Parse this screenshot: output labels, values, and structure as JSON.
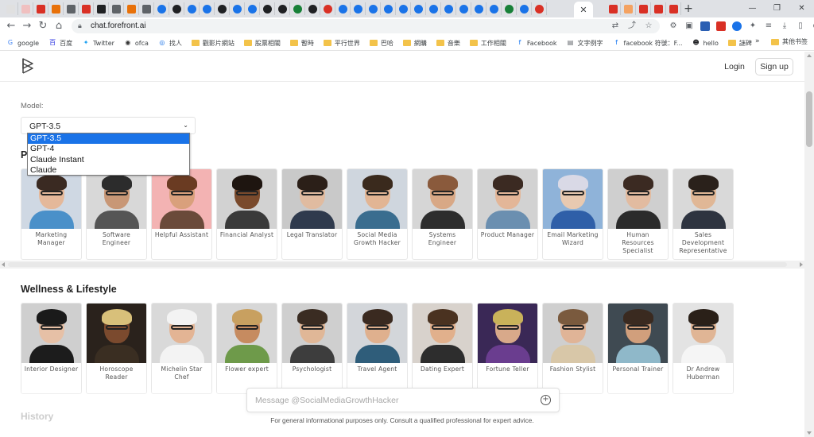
{
  "browser": {
    "url": "chat.forefront.ai",
    "window_controls": {
      "minimize": "—",
      "restore": "❐",
      "close": "✕"
    },
    "active_tab_close": "✕",
    "new_tab": "+",
    "bookmarks": [
      {
        "label": "google",
        "icon": "google-icon"
      },
      {
        "label": "百度",
        "icon": "baidu-icon"
      },
      {
        "label": "Twitter",
        "icon": "twitter-icon"
      },
      {
        "label": "ofca",
        "icon": "globe-icon"
      },
      {
        "label": "找人",
        "icon": "chrome-icon"
      },
      {
        "label": "觀影片網站",
        "icon": "folder-icon"
      },
      {
        "label": "股票相關",
        "icon": "folder-icon"
      },
      {
        "label": "暫時",
        "icon": "folder-icon"
      },
      {
        "label": "平行世界",
        "icon": "folder-icon"
      },
      {
        "label": "巴哈",
        "icon": "folder-icon"
      },
      {
        "label": "網購",
        "icon": "folder-icon"
      },
      {
        "label": "音樂",
        "icon": "folder-icon"
      },
      {
        "label": "工作相關",
        "icon": "folder-icon"
      },
      {
        "label": "Facebook",
        "icon": "facebook-icon"
      },
      {
        "label": "文字例字",
        "icon": "doc-icon"
      },
      {
        "label": "facebook 符號：F...",
        "icon": "facebook-icon"
      },
      {
        "label": "hello",
        "icon": "user-icon"
      },
      {
        "label": "謎碑",
        "icon": "folder-icon"
      }
    ],
    "bookmarks_more": "»",
    "other_bookmarks": "其他书签"
  },
  "header": {
    "login_label": "Login",
    "signup_label": "Sign up"
  },
  "model": {
    "label": "Model:",
    "selected": "GPT-3.5",
    "options": [
      "GPT-3.5",
      "GPT-4",
      "Claude Instant",
      "Claude"
    ]
  },
  "section1": {
    "title_partial": "P",
    "cards": [
      {
        "label": "Marketing Manager",
        "colors": [
          "#cfd8e3",
          "#e4b89a",
          "#3a2a22",
          "#4a90c9"
        ]
      },
      {
        "label": "Software Engineer",
        "colors": [
          "#d8d8d8",
          "#c89776",
          "#2c2c2c",
          "#555555"
        ]
      },
      {
        "label": "Helpful Assistant",
        "colors": [
          "#f3b3b3",
          "#d9a07c",
          "#6a3b22",
          "#6a4a3a"
        ]
      },
      {
        "label": "Financial Analyst",
        "colors": [
          "#d2d2d2",
          "#7a4a2c",
          "#1e1510",
          "#3a3a3a"
        ]
      },
      {
        "label": "Legal Translator",
        "colors": [
          "#c9c9c9",
          "#e0bba0",
          "#2b1f18",
          "#2f3a4d"
        ]
      },
      {
        "label": "Social Media Growth Hacker",
        "colors": [
          "#cfd6de",
          "#e2b594",
          "#3a2a1d",
          "#3a6d8f"
        ]
      },
      {
        "label": "Systems Engineer",
        "colors": [
          "#d6d6d6",
          "#d8a886",
          "#8a5a3c",
          "#2d2d2d"
        ]
      },
      {
        "label": "Product Manager",
        "colors": [
          "#d2d2d2",
          "#e3b698",
          "#3b2a22",
          "#6b8fb0"
        ]
      },
      {
        "label": "Email Marketing Wizard",
        "colors": [
          "#8fb3d9",
          "#e8c9b0",
          "#d9d9e6",
          "#2f5fa8"
        ]
      },
      {
        "label": "Human Resources Specialist",
        "colors": [
          "#cfcfcf",
          "#e2bba0",
          "#3b2a22",
          "#2b2b2b"
        ]
      },
      {
        "label": "Sales Development Representative",
        "colors": [
          "#d9d9d9",
          "#e0b796",
          "#2a211b",
          "#2e3440"
        ]
      }
    ]
  },
  "section2": {
    "title": "Wellness & Lifestyle",
    "cards": [
      {
        "label": "Interior Designer",
        "colors": [
          "#cfcfcf",
          "#e6c0a6",
          "#1a1a1a",
          "#1c1c1c"
        ]
      },
      {
        "label": "Horoscope Reader",
        "colors": [
          "#2a221c",
          "#7b4a2e",
          "#d8c07a",
          "#3a2e22"
        ]
      },
      {
        "label": "Michelin Star Chef",
        "colors": [
          "#d9d9d9",
          "#e3b494",
          "#f3f3f3",
          "#f3f3f3"
        ]
      },
      {
        "label": "Flower expert",
        "colors": [
          "#d7d7d7",
          "#c68b60",
          "#c8a060",
          "#6e9a4a"
        ]
      },
      {
        "label": "Psychologist",
        "colors": [
          "#cfcfcf",
          "#e0b797",
          "#3a2c22",
          "#3d3d3d"
        ]
      },
      {
        "label": "Travel Agent",
        "colors": [
          "#d3d6da",
          "#dfb08e",
          "#3a2a20",
          "#2f5d7a"
        ]
      },
      {
        "label": "Dating Expert",
        "colors": [
          "#d8d2cc",
          "#e1b08c",
          "#4a3220",
          "#2d2d2d"
        ]
      },
      {
        "label": "Fortune Teller",
        "colors": [
          "#3a2856",
          "#d8a98a",
          "#c9b25a",
          "#6a3d8f"
        ]
      },
      {
        "label": "Fashion Stylist",
        "colors": [
          "#cfcfcf",
          "#e0b497",
          "#7a5a3e",
          "#d8c7a8"
        ]
      },
      {
        "label": "Personal Trainer",
        "colors": [
          "#3f4a52",
          "#d19f7c",
          "#3a2a20",
          "#8fb8c9"
        ]
      },
      {
        "label": "Dr Andrew Huberman",
        "colors": [
          "#e3e3e3",
          "#e0b595",
          "#2a2018",
          "#f5f5f5"
        ]
      }
    ]
  },
  "section3": {
    "title_partial": "History"
  },
  "composer": {
    "placeholder": "Message @SocialMediaGrowthHacker",
    "disclaimer": "For general informational purposes only. Consult a qualified professional for expert advice."
  }
}
